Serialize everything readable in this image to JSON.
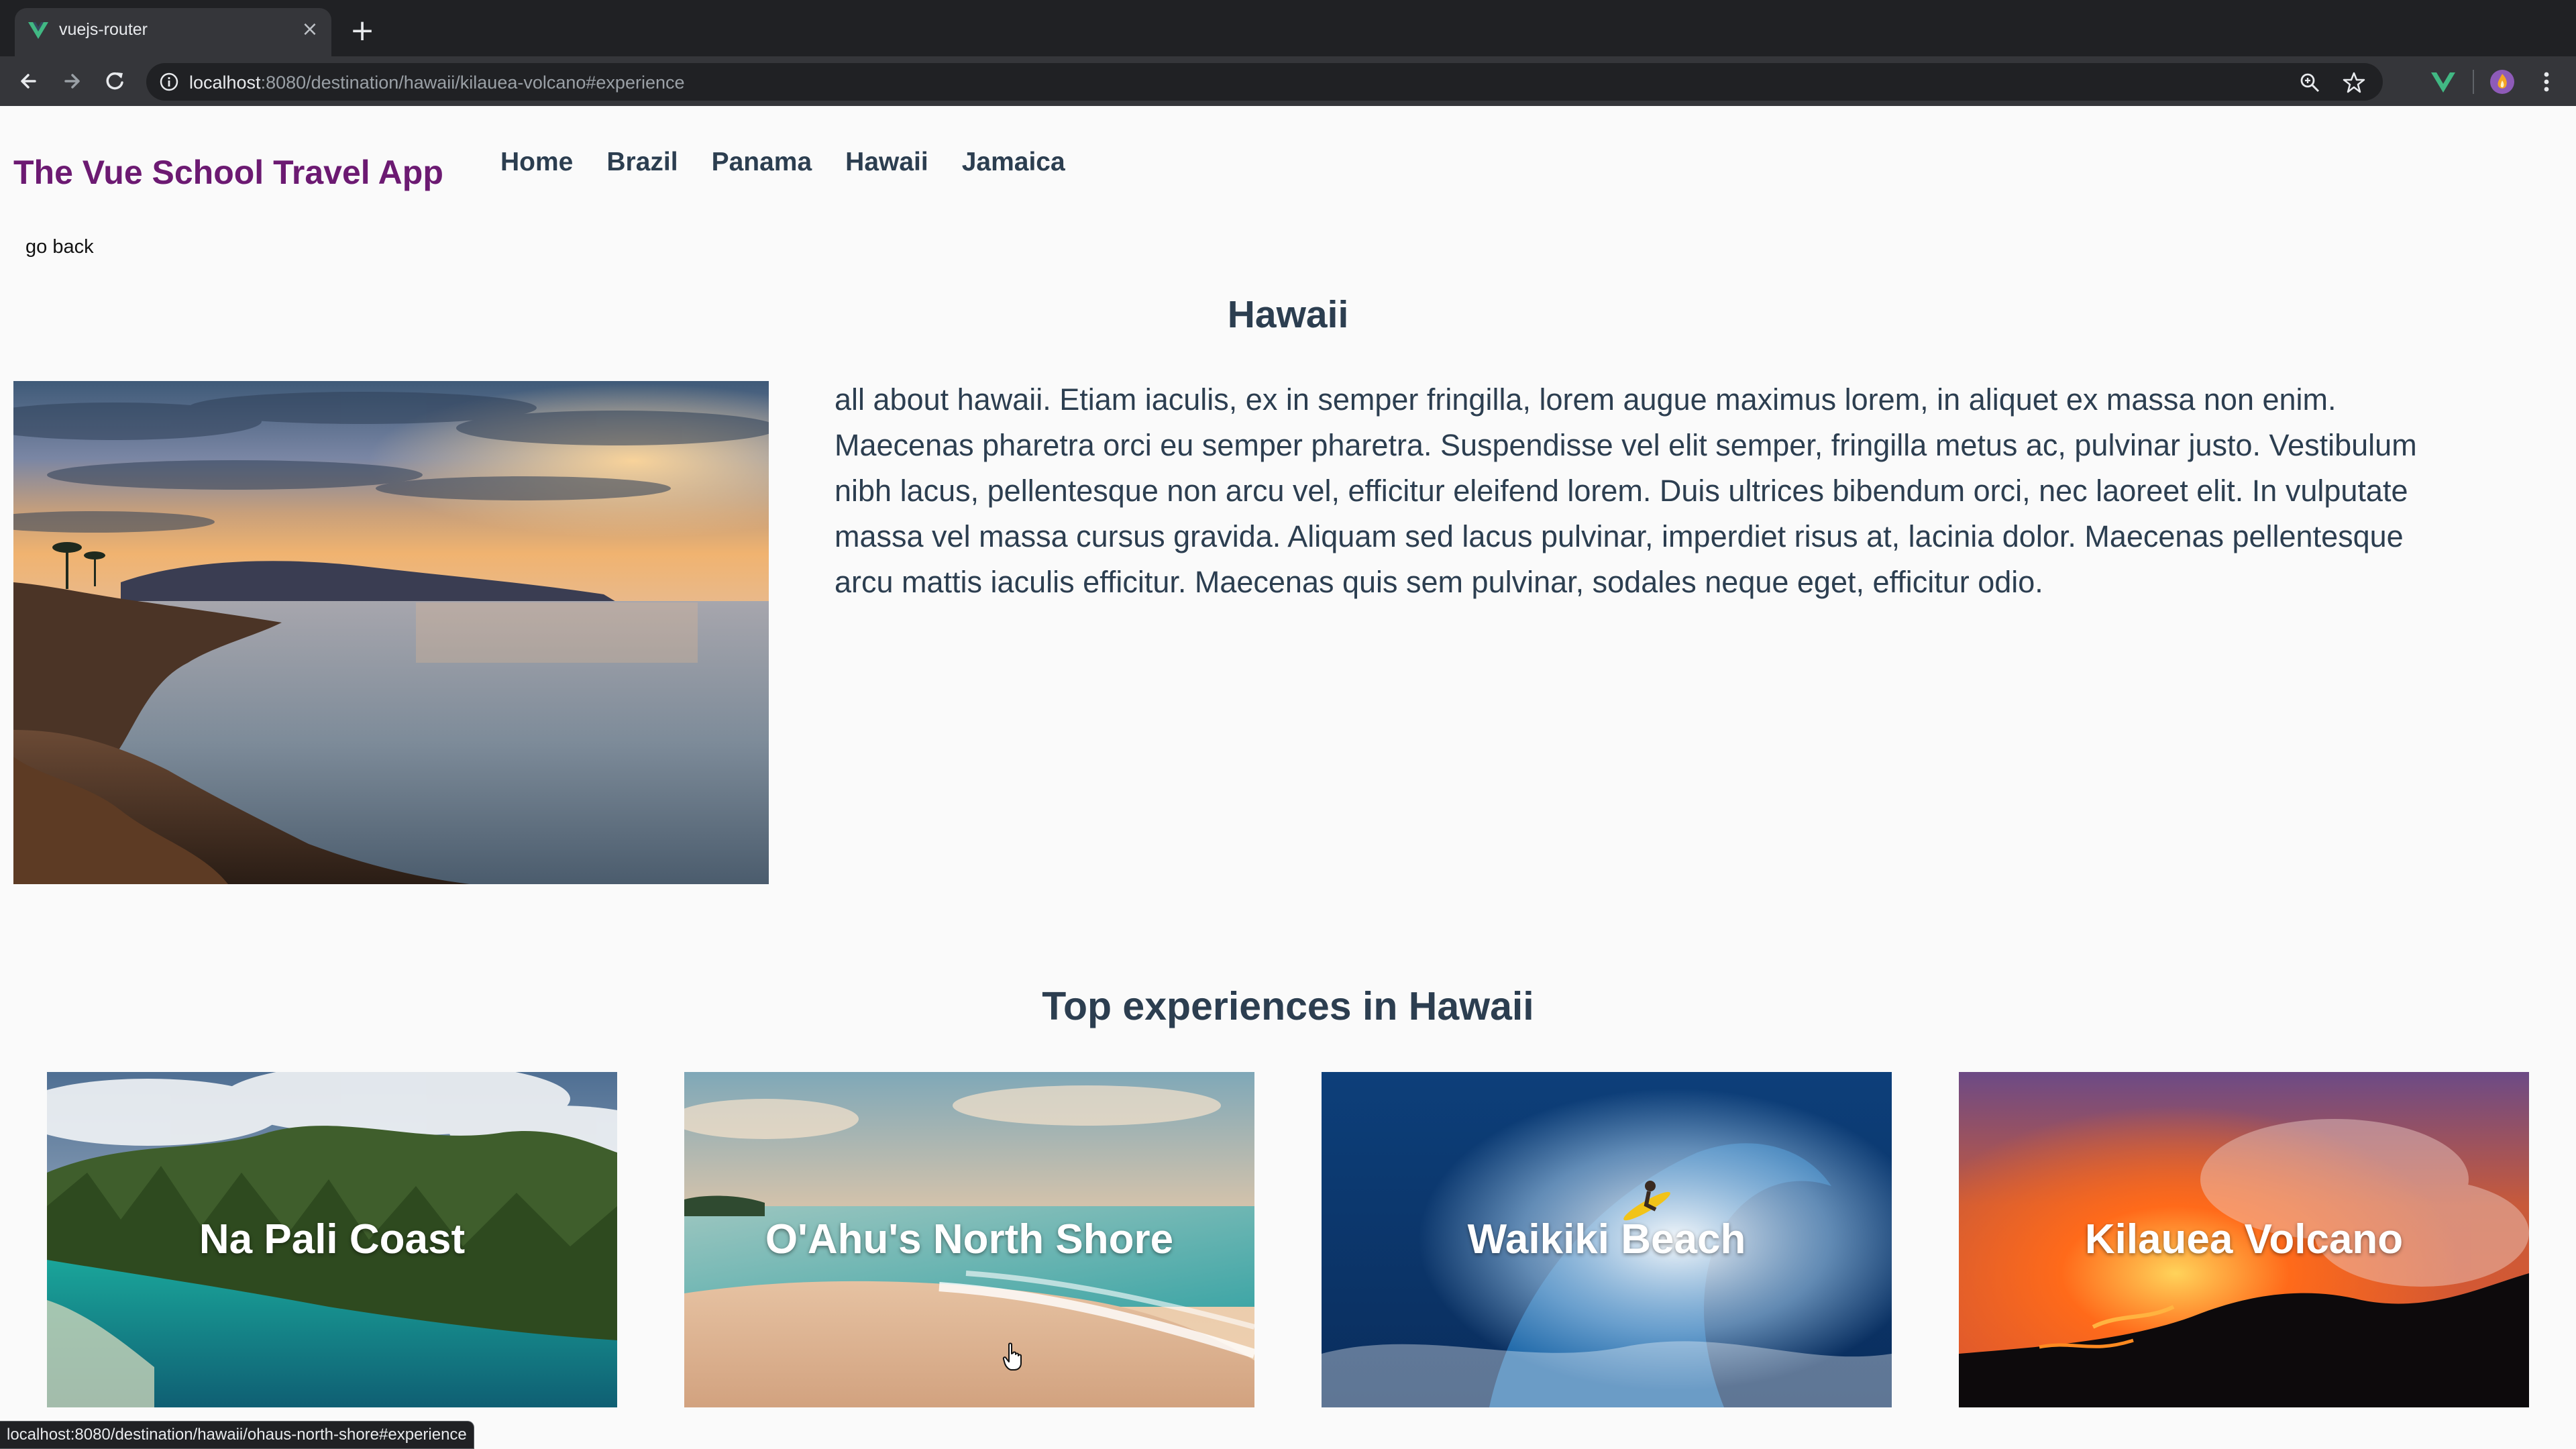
{
  "browser": {
    "tab_title": "vuejs-router",
    "close_glyph": "×",
    "newtab_glyph": "+",
    "url_host": "localhost",
    "url_path": ":8080/destination/hawaii/kilauea-volcano#experience",
    "status_url": "localhost:8080/destination/hawaii/ohaus-north-shore#experience",
    "icons": [
      "vue-favicon-icon",
      "back-arrow-icon",
      "forward-arrow-icon",
      "reload-icon",
      "info-icon",
      "zoom-icon",
      "star-icon",
      "vue-devtools-icon",
      "profile-avatar-icon",
      "menu-dots-icon"
    ]
  },
  "colors": {
    "brand": "#6c1a72",
    "text": "#2c3e50",
    "chrome_dark": "#202124",
    "chrome_toolbar": "#35363a",
    "vue_green": "#41b883"
  },
  "app": {
    "brand": "The Vue School Travel App",
    "nav": [
      "Home",
      "Brazil",
      "Panama",
      "Hawaii",
      "Jamaica"
    ],
    "go_back": "go back"
  },
  "destination": {
    "name": "Hawaii",
    "description": "all about hawaii. Etiam iaculis, ex in semper fringilla, lorem augue maximus lorem, in aliquet ex massa non enim. Maecenas pharetra orci eu semper pharetra. Suspendisse vel elit semper, fringilla metus ac, pulvinar justo. Vestibulum nibh lacus, pellentesque non arcu vel, efficitur eleifend lorem. Duis ultrices bibendum orci, nec laoreet elit. In vulputate massa vel massa cursus gravida. Aliquam sed lacus pulvinar, imperdiet risus at, lacinia dolor. Maecenas pellentesque arcu mattis iaculis efficitur. Maecenas quis sem pulvinar, sodales neque eget, efficitur odio."
  },
  "experiences": {
    "heading": "Top experiences in Hawaii",
    "items": [
      {
        "name": "Na Pali Coast"
      },
      {
        "name": "O'Ahu's North Shore"
      },
      {
        "name": "Waikiki Beach"
      },
      {
        "name": "Kilauea Volcano"
      }
    ]
  }
}
